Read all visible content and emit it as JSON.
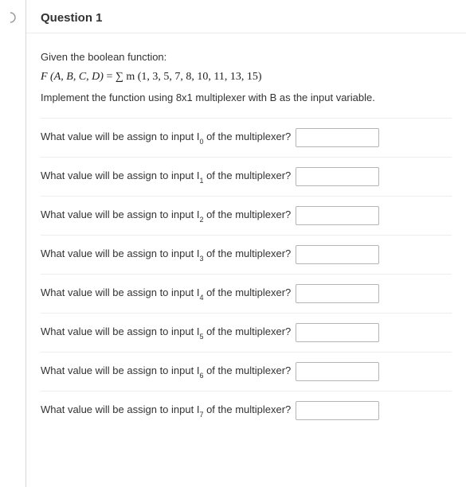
{
  "question": {
    "title": "Question 1",
    "prompt": "Given the boolean function:",
    "formula_var": "F (A, B, C, D)",
    "formula_eq": " = ",
    "formula_sigma": "∑ m",
    "formula_terms": " (1, 3, 5, 7, 8, 10, 11, 13, 15)",
    "instruction": "Implement the function using 8x1 multiplexer with B as the input variable."
  },
  "fields": {
    "label_prefix": "What value will be assign to input I",
    "label_suffix": " of the multiplexer?",
    "items": [
      {
        "sub": "0",
        "value": ""
      },
      {
        "sub": "1",
        "value": ""
      },
      {
        "sub": "2",
        "value": ""
      },
      {
        "sub": "3",
        "value": ""
      },
      {
        "sub": "4",
        "value": ""
      },
      {
        "sub": "5",
        "value": ""
      },
      {
        "sub": "6",
        "value": ""
      },
      {
        "sub": "7",
        "value": ""
      }
    ]
  }
}
